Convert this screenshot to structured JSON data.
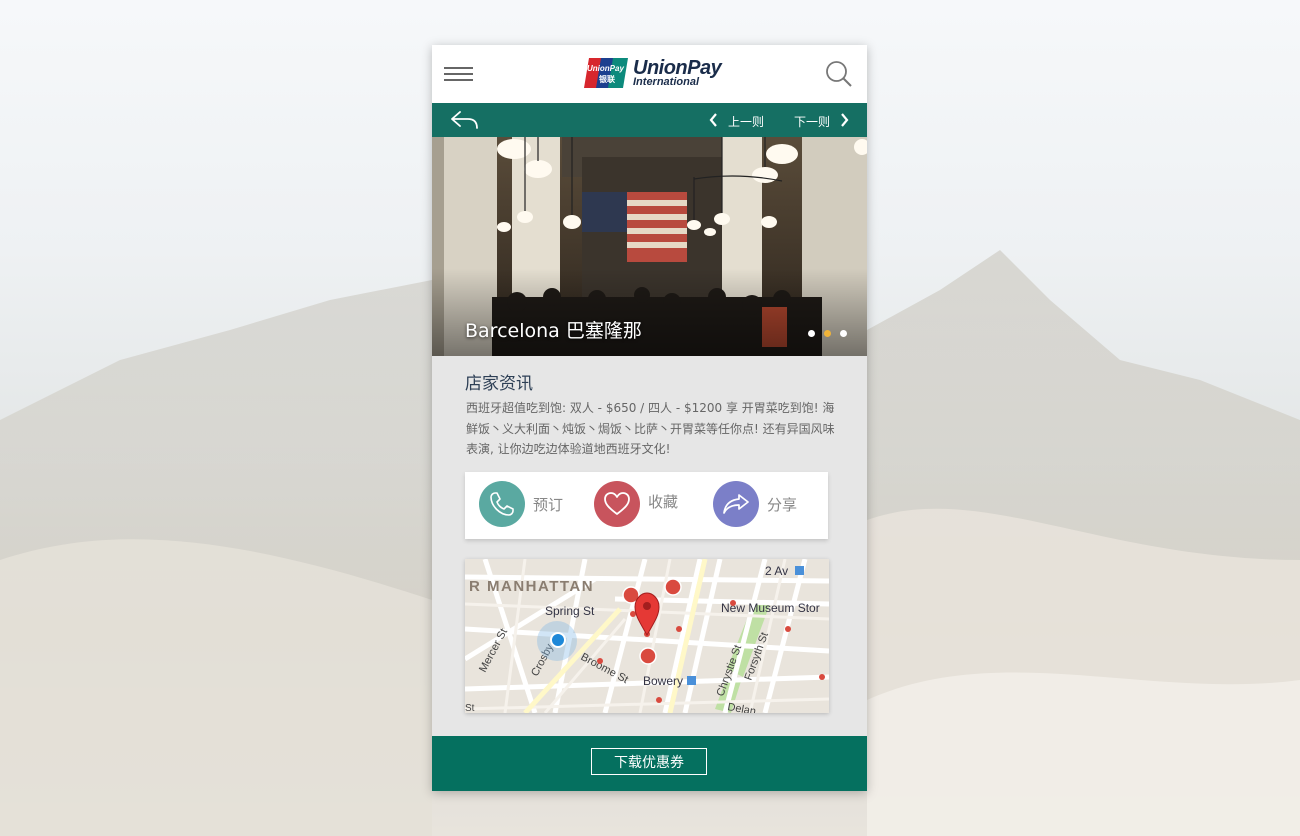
{
  "header": {
    "brand_line1": "UnionPay",
    "brand_line2": "International",
    "logo_mark_text1": "UnionPay",
    "logo_mark_text2": "银联",
    "menu_icon": "hamburger-menu-icon",
    "search_icon": "search-icon"
  },
  "navbar": {
    "back_icon": "reply-back-icon",
    "prev_label": "上一则",
    "next_label": "下一则"
  },
  "hero": {
    "title": "Barcelona 巴塞隆那",
    "carousel_dots": 3,
    "active_dot": 2
  },
  "store_info": {
    "title": "店家资讯",
    "description": "西班牙超值吃到饱: 双人 - $650 / 四人 - $1200 享 开胃菜吃到饱! 海鲜饭丶义大利面丶炖饭丶焗饭丶比萨丶开胃菜等任你点! 还有异国风味表演, 让你边吃边体验道地西班牙文化!"
  },
  "actions": [
    {
      "label": "预订",
      "icon": "phone-icon",
      "color": "#5aa9a1"
    },
    {
      "label": "收藏",
      "icon": "heart-icon",
      "color": "#c8545d"
    },
    {
      "label": "分享",
      "icon": "share-icon",
      "color": "#7b7fc8"
    }
  ],
  "map": {
    "labels": {
      "area": "R MANHATTAN",
      "spring": "Spring St",
      "mercer": "Mercer St",
      "crosby": "Crosby",
      "broome": "Broome St",
      "bowery": "Bowery",
      "chrystie": "Chrystie St",
      "forsyth": "Forsyth St",
      "second_av": "2 Av",
      "museum": "New Museum Stor",
      "delancey": "Delan",
      "st": "St"
    }
  },
  "footer": {
    "download_label": "下载优惠券"
  },
  "colors": {
    "accent": "#156f63",
    "footer": "#05705f",
    "active_dot": "#f0b43a"
  }
}
